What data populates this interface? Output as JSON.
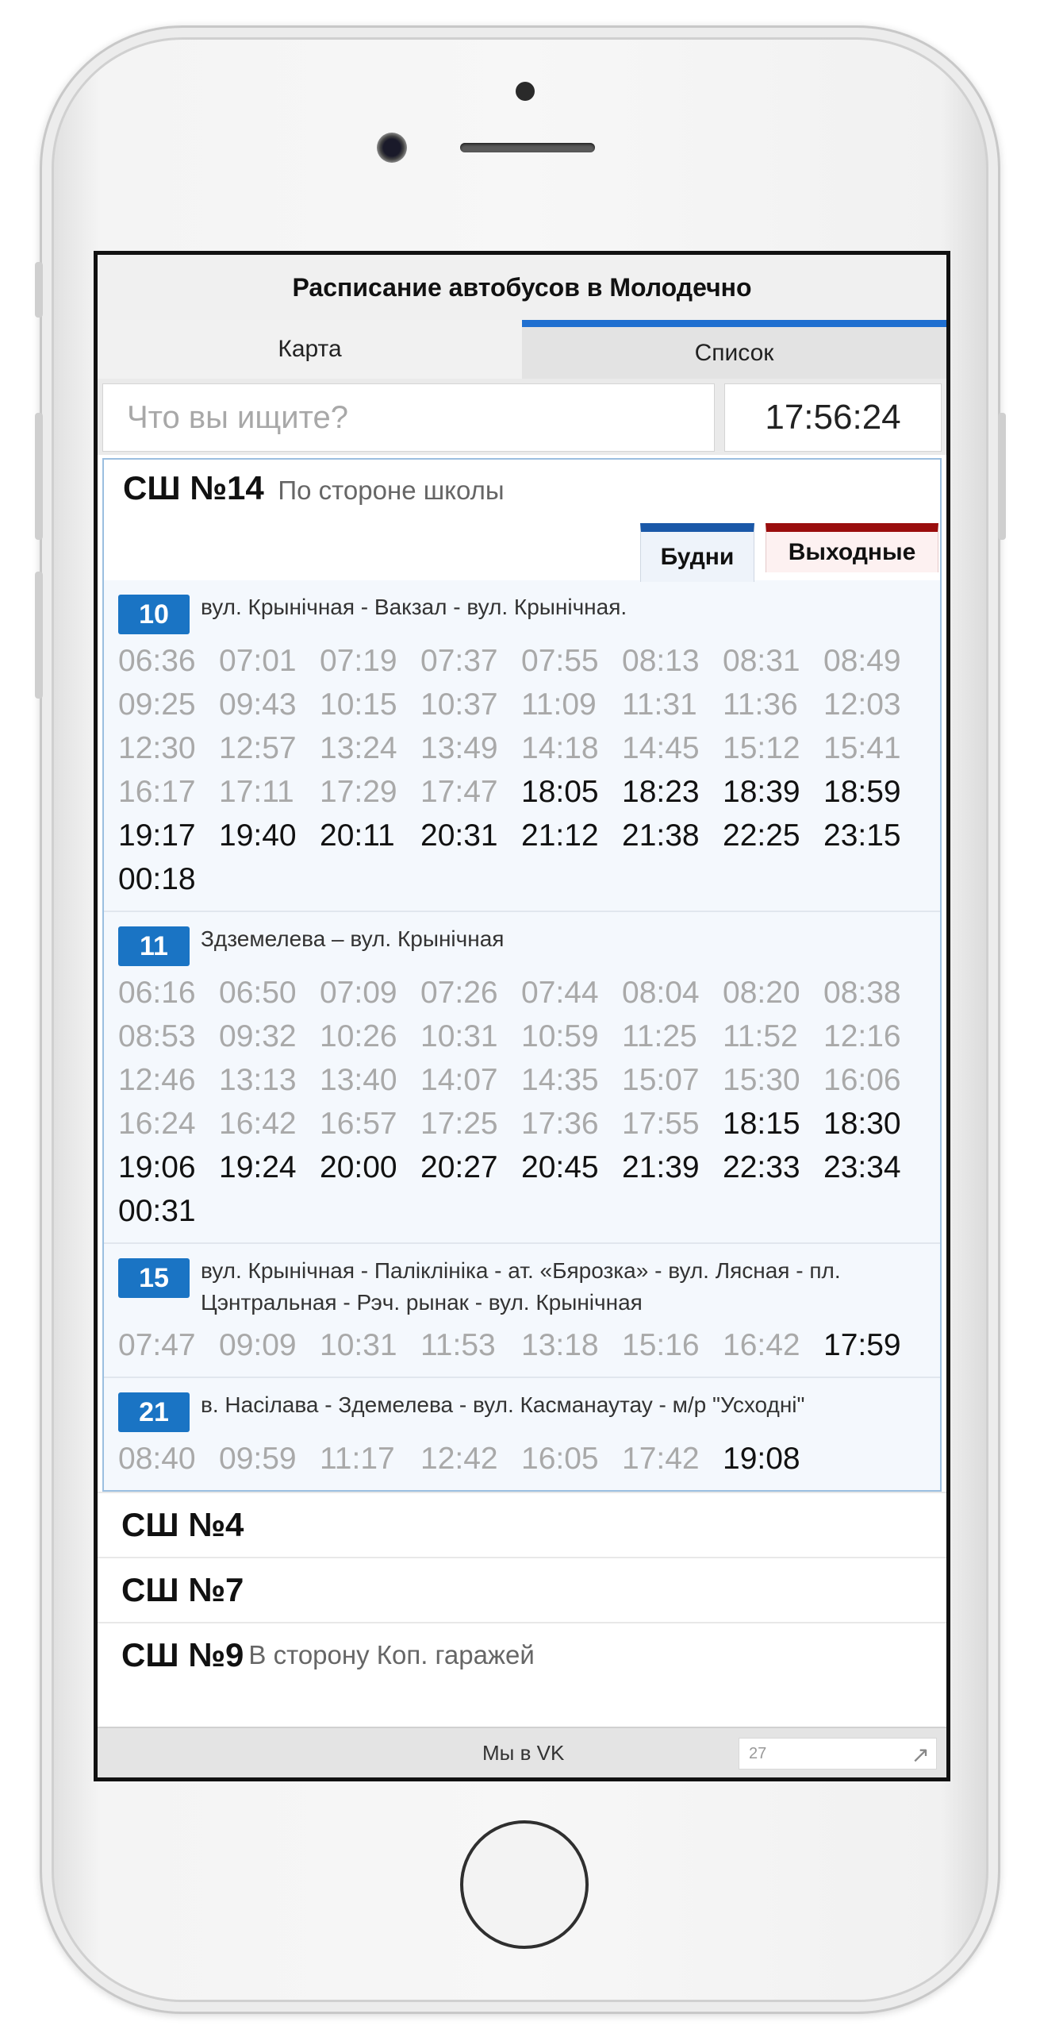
{
  "app": {
    "title": "Расписание автобусов в Молодечно"
  },
  "tabs": {
    "map": "Карта",
    "list": "Список"
  },
  "search": {
    "placeholder": "Что вы ищите?"
  },
  "clock": "17:56:24",
  "stop": {
    "name": "СШ №14",
    "direction": "По стороне школы",
    "day_tabs": {
      "weekdays": "Будни",
      "weekends": "Выходные"
    },
    "routes": [
      {
        "number": "10",
        "name": "вул. Крынічная - Вакзал - вул. Крынічная.",
        "past": [
          "06:36",
          "07:01",
          "07:19",
          "07:37",
          "07:55",
          "08:13",
          "08:31",
          "08:49",
          "09:25",
          "09:43",
          "10:15",
          "10:37",
          "11:09",
          "11:31",
          "11:36",
          "12:03",
          "12:30",
          "12:57",
          "13:24",
          "13:49",
          "14:18",
          "14:45",
          "15:12",
          "15:41",
          "16:17",
          "17:11",
          "17:29",
          "17:47"
        ],
        "upcoming": [
          "18:05",
          "18:23",
          "18:39",
          "18:59",
          "19:17",
          "19:40",
          "20:11",
          "20:31",
          "21:12",
          "21:38",
          "22:25",
          "23:15",
          "00:18"
        ]
      },
      {
        "number": "11",
        "name": "Здземелева – вул. Крынічная",
        "past": [
          "06:16",
          "06:50",
          "07:09",
          "07:26",
          "07:44",
          "08:04",
          "08:20",
          "08:38",
          "08:53",
          "09:32",
          "10:26",
          "10:31",
          "10:59",
          "11:25",
          "11:52",
          "12:16",
          "12:46",
          "13:13",
          "13:40",
          "14:07",
          "14:35",
          "15:07",
          "15:30",
          "16:06",
          "16:24",
          "16:42",
          "16:57",
          "17:25",
          "17:36",
          "17:55"
        ],
        "upcoming": [
          "18:15",
          "18:30",
          "19:06",
          "19:24",
          "20:00",
          "20:27",
          "20:45",
          "21:39",
          "22:33",
          "23:34",
          "00:31"
        ]
      },
      {
        "number": "15",
        "name": "вул. Крынічная - Паліклініка - ат. «Бярозка» - вул. Лясная - пл. Цэнтральная - Рэч. рынак - вул. Крынічная",
        "past": [
          "07:47",
          "09:09",
          "10:31",
          "11:53",
          "13:18",
          "15:16",
          "16:42"
        ],
        "upcoming": [
          "17:59"
        ]
      },
      {
        "number": "21",
        "name": "в. Насілава - Здемелева - вул. Касманаутау - м/р \"Усходні\"",
        "past": [
          "08:40",
          "09:59",
          "11:17",
          "12:42",
          "16:05",
          "17:42"
        ],
        "upcoming": [
          "19:08"
        ]
      }
    ]
  },
  "other_stops": [
    {
      "name": "СШ №4",
      "direction": ""
    },
    {
      "name": "СШ №7",
      "direction": ""
    },
    {
      "name": "СШ №9",
      "direction": "В сторону Коп. гаражей"
    }
  ],
  "footer": {
    "vk_link": "Мы в VK",
    "counter": "27",
    "counter_icon": "arrow-up-right-icon"
  },
  "colors": {
    "accent_blue": "#1a74c4",
    "tab_blue": "#1f6fd0",
    "weekend_red": "#9a0d0d",
    "past_time": "#a9a9a9"
  }
}
